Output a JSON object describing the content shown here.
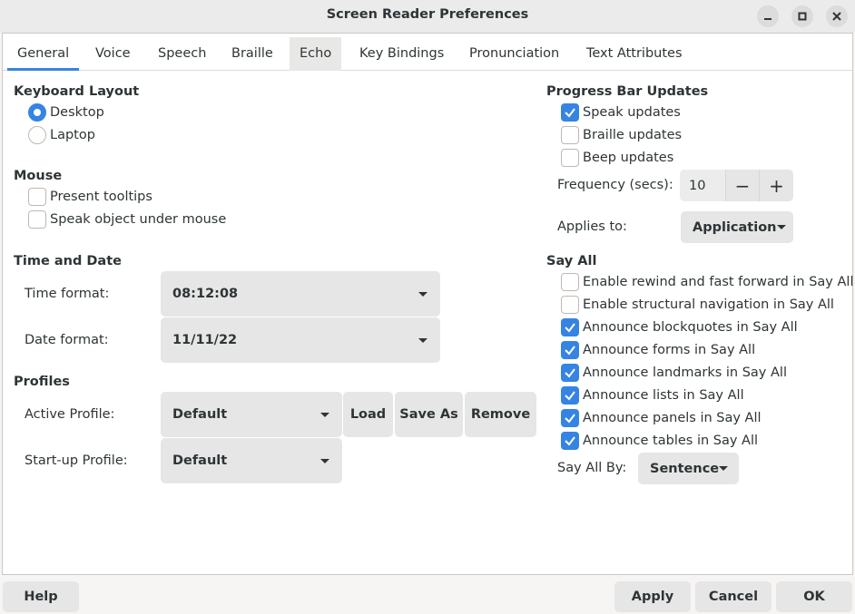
{
  "window": {
    "title": "Screen Reader Preferences"
  },
  "tabs": [
    {
      "label": "General"
    },
    {
      "label": "Voice"
    },
    {
      "label": "Speech"
    },
    {
      "label": "Braille"
    },
    {
      "label": "Echo"
    },
    {
      "label": "Key Bindings"
    },
    {
      "label": "Pronunciation"
    },
    {
      "label": "Text Attributes"
    }
  ],
  "active_tab": "General",
  "keyboard_layout": {
    "heading": "Keyboard Layout",
    "options": [
      {
        "label": "Desktop",
        "selected": true
      },
      {
        "label": "Laptop",
        "selected": false
      }
    ]
  },
  "mouse": {
    "heading": "Mouse",
    "options": [
      {
        "label": "Present tooltips",
        "checked": false
      },
      {
        "label": "Speak object under mouse",
        "checked": false
      }
    ]
  },
  "time_date": {
    "heading": "Time and Date",
    "time_label": "Time format:",
    "time_value": "08:12:08",
    "date_label": "Date format:",
    "date_value": "11/11/22"
  },
  "profiles": {
    "heading": "Profiles",
    "active_label": "Active Profile:",
    "active_value": "Default",
    "startup_label": "Start-up Profile:",
    "startup_value": "Default",
    "load_label": "Load",
    "save_as_label": "Save As",
    "remove_label": "Remove"
  },
  "progress": {
    "heading": "Progress Bar Updates",
    "options": [
      {
        "label": "Speak updates",
        "checked": true
      },
      {
        "label": "Braille updates",
        "checked": false
      },
      {
        "label": "Beep updates",
        "checked": false
      }
    ],
    "frequency_label": "Frequency (secs):",
    "frequency_value": "10",
    "minus": "−",
    "plus": "+",
    "applies_label": "Applies to:",
    "applies_value": "Application"
  },
  "say_all": {
    "heading": "Say All",
    "options": [
      {
        "label": "Enable rewind and fast forward in Say All",
        "checked": false
      },
      {
        "label": "Enable structural navigation in Say All",
        "checked": false
      },
      {
        "label": "Announce blockquotes in Say All",
        "checked": true
      },
      {
        "label": "Announce forms in Say All",
        "checked": true
      },
      {
        "label": "Announce landmarks in Say All",
        "checked": true
      },
      {
        "label": "Announce lists in Say All",
        "checked": true
      },
      {
        "label": "Announce panels in Say All",
        "checked": true
      },
      {
        "label": "Announce tables in Say All",
        "checked": true
      }
    ],
    "by_label": "Say All By:",
    "by_value": "Sentence"
  },
  "footer": {
    "help": "Help",
    "apply": "Apply",
    "cancel": "Cancel",
    "ok": "OK"
  },
  "colors": {
    "accent": "#3584e4",
    "window_bg": "#f6f5f4",
    "button_bg": "#e6e6e6"
  }
}
